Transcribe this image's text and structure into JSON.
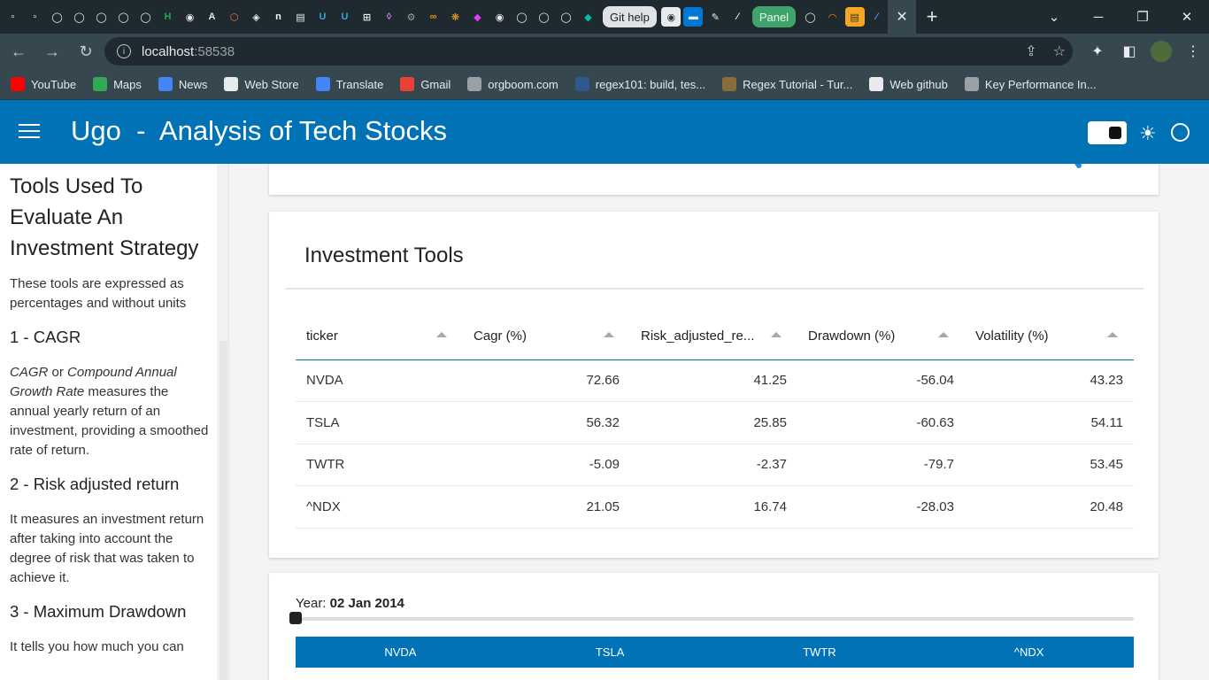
{
  "browser": {
    "tab_pills": {
      "git_help": "Git help",
      "panel": "Panel"
    },
    "tab_icons_left": [
      "alx-icon",
      "alx-icon",
      "github-icon",
      "github-icon",
      "github-icon",
      "github-icon",
      "github-icon",
      "hackerrank-icon",
      "web-icon",
      "web-icon",
      "web-icon",
      "web-icon",
      "n-icon",
      "web-icon",
      "u-icon",
      "u-icon",
      "web-icon",
      "web-icon",
      "web-icon",
      "web-icon",
      "web-icon",
      "web-icon",
      "web-icon",
      "web-icon",
      "github-icon",
      "github-icon",
      "web-icon"
    ],
    "url_host": "localhost",
    "url_port": ":58538",
    "bookmarks": [
      {
        "label": "YouTube",
        "icon": "youtube-icon",
        "color": "#ff0000"
      },
      {
        "label": "Maps",
        "icon": "maps-icon",
        "color": "#34a853"
      },
      {
        "label": "News",
        "icon": "news-icon",
        "color": "#4285f4"
      },
      {
        "label": "Web Store",
        "icon": "webstore-icon",
        "color": "#e8eaed"
      },
      {
        "label": "Translate",
        "icon": "translate-icon",
        "color": "#4285f4"
      },
      {
        "label": "Gmail",
        "icon": "gmail-icon",
        "color": "#ea4335"
      },
      {
        "label": "orgboom.com",
        "icon": "globe-icon",
        "color": "#9aa0a6"
      },
      {
        "label": "regex101: build, tes...",
        "icon": "regex101-icon",
        "color": "#2d5a8c"
      },
      {
        "label": "Regex Tutorial - Tur...",
        "icon": "owl-icon",
        "color": "#8a6d3b"
      },
      {
        "label": "Web github",
        "icon": "github-icon",
        "color": "#e8eaed"
      },
      {
        "label": "Key Performance In...",
        "icon": "kpi-icon",
        "color": "#9aa0a6"
      }
    ]
  },
  "header": {
    "title": "Ugo  -  Analysis of Tech Stocks",
    "accent": "#0072b5"
  },
  "sidebar": {
    "title": "Tools Used To Evaluate An Investment Strategy",
    "intro": "These tools are expressed as percentages and without units",
    "sections": [
      {
        "heading": "1 - CAGR",
        "body_em1": "CAGR",
        "body_mid": " or ",
        "body_em2": "Compound Annual Growth Rate",
        "body_rest": " measures the annual yearly return of an investment, providing a smoothed rate of return."
      },
      {
        "heading": "2 - Risk adjusted return",
        "body": "It measures an investment return after taking into account the degree of risk that was taken to achieve it."
      },
      {
        "heading": "3 - Maximum Drawdown",
        "body": "It tells you how much you can"
      }
    ]
  },
  "tools_card": {
    "title": "Investment Tools",
    "columns": [
      "ticker",
      "Cagr (%)",
      "Risk_adjusted_re...",
      "Drawdown (%)",
      "Volatility (%)"
    ],
    "rows": [
      [
        "NVDA",
        "72.66",
        "41.25",
        "-56.04",
        "43.23"
      ],
      [
        "TSLA",
        "56.32",
        "25.85",
        "-60.63",
        "54.11"
      ],
      [
        "TWTR",
        "-5.09",
        "-2.37",
        "-79.7",
        "53.45"
      ],
      [
        "^NDX",
        "21.05",
        "16.74",
        "-28.03",
        "20.48"
      ]
    ]
  },
  "slider_card": {
    "year_label": "Year: ",
    "year_value": "02 Jan 2014",
    "slider_fraction": 0.0,
    "tabs": [
      "NVDA",
      "TSLA",
      "TWTR",
      "^NDX"
    ]
  }
}
